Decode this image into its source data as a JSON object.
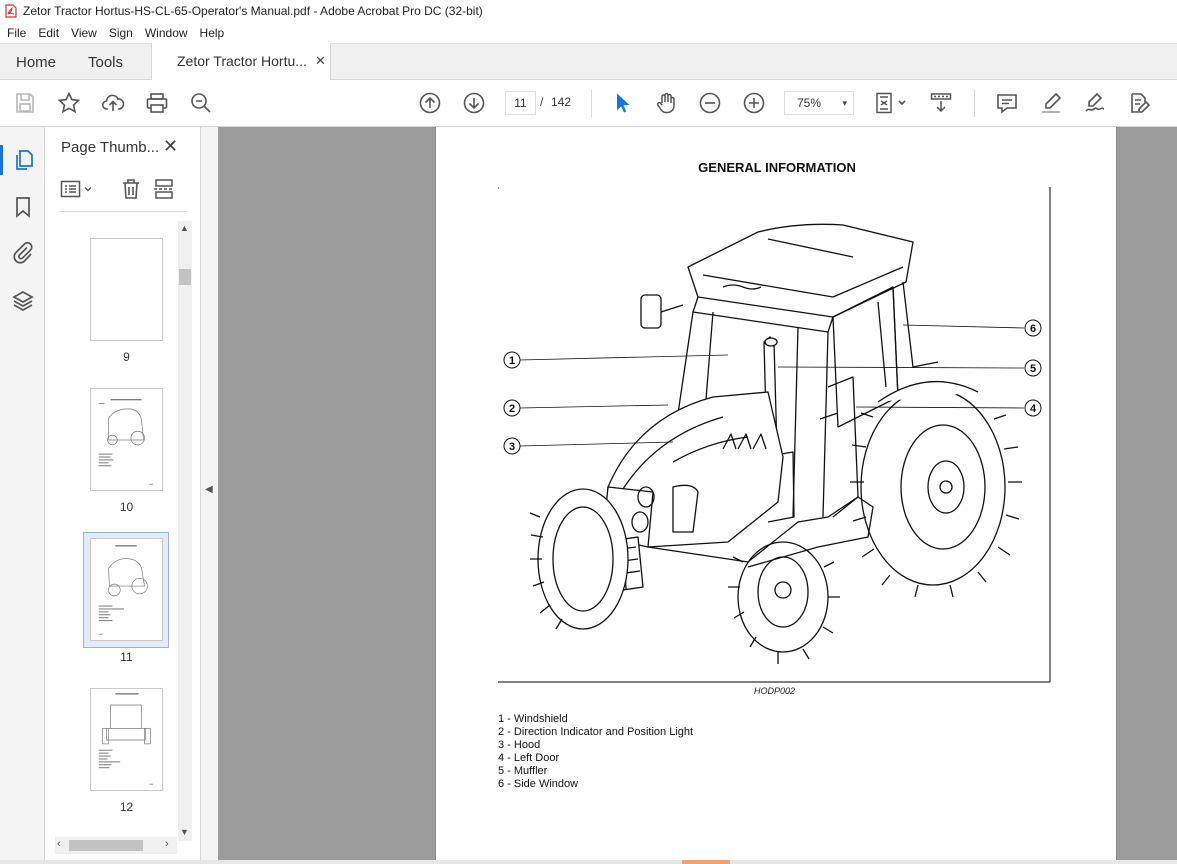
{
  "window": {
    "title": "Zetor Tractor Hortus-HS-CL-65-Operator's Manual.pdf - Adobe Acrobat Pro DC (32-bit)"
  },
  "menu": [
    "File",
    "Edit",
    "View",
    "Sign",
    "Window",
    "Help"
  ],
  "tabs": {
    "home": "Home",
    "tools": "Tools",
    "document": "Zetor Tractor Hortu...",
    "close_glyph": "✕"
  },
  "toolbar": {
    "current_page": "11",
    "page_separator": "/",
    "total_pages": "142",
    "zoom": "75%",
    "zoom_chevron": "▾"
  },
  "thumbnail_panel": {
    "title": "Page Thumb...",
    "close_glyph": "✕",
    "thumbnails": [
      {
        "page": "9"
      },
      {
        "page": "10"
      },
      {
        "page": "11",
        "selected": true
      },
      {
        "page": "12"
      }
    ]
  },
  "document": {
    "heading": "GENERAL INFORMATION",
    "figure_code": "HODP002",
    "callouts": [
      "1",
      "2",
      "3",
      "4",
      "5",
      "6"
    ],
    "legend": [
      "1 - Windshield",
      "2 - Direction Indicator and Position Light",
      "3 - Hood",
      "4 - Left Door",
      "5 - Muffler",
      "6 - Side Window"
    ]
  },
  "colors": {
    "accent": "#1473e6",
    "canvas": "#9b9b9b",
    "pdf_icon": "#d7312a"
  },
  "icons": {
    "toolbar": [
      "save-icon",
      "star-icon",
      "upload-icon",
      "print-icon",
      "zoom-search-icon",
      "page-up-icon",
      "page-down-icon",
      "select-cursor-icon",
      "hand-icon",
      "zoom-out-icon",
      "zoom-in-icon",
      "fit-page-icon",
      "scroll-mode-icon",
      "comment-icon",
      "highlight-icon",
      "sign-icon",
      "edit-pdf-icon"
    ],
    "rail": [
      "page-thumbnails-icon",
      "bookmark-icon",
      "attachment-icon",
      "layers-icon"
    ]
  }
}
